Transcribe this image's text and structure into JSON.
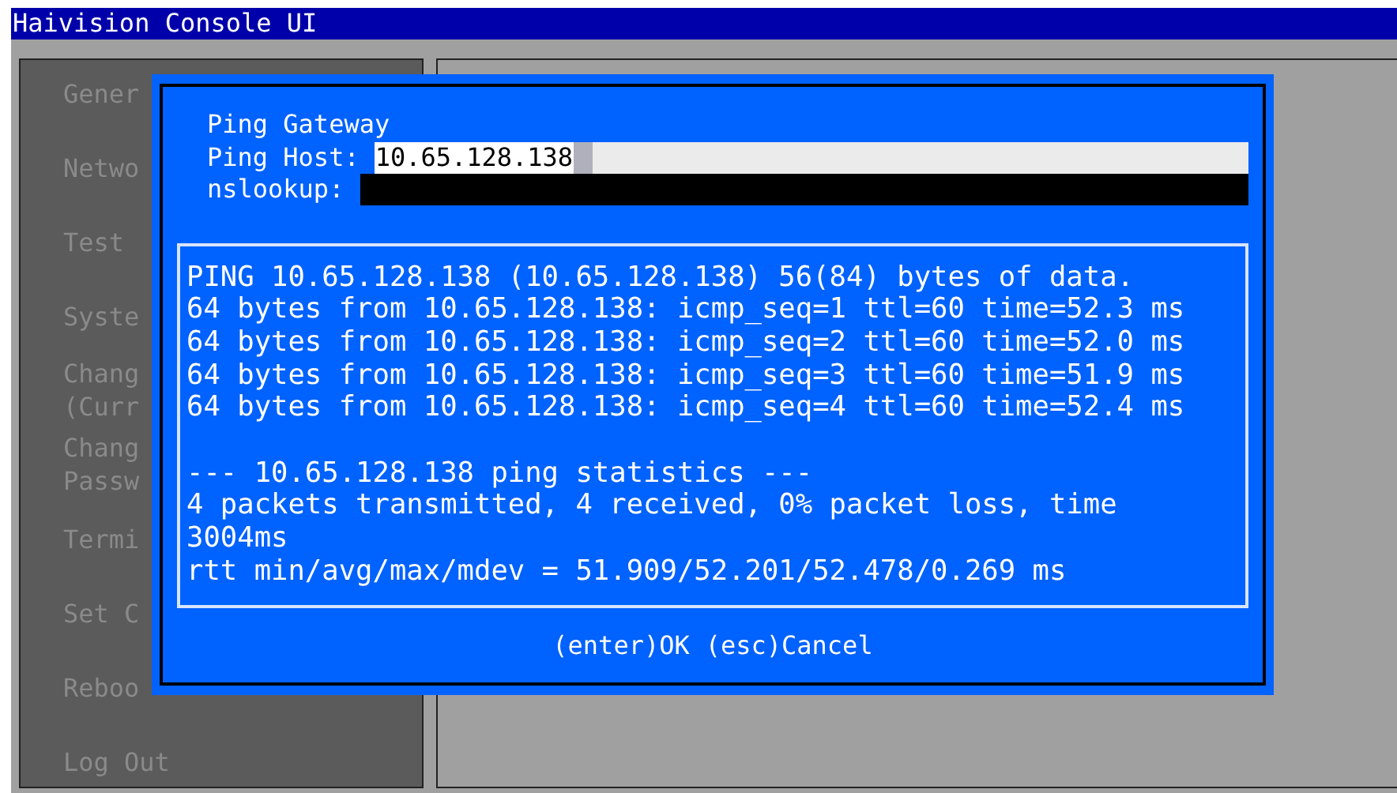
{
  "window": {
    "title": "Haivision Console UI"
  },
  "sidebar": {
    "items": [
      {
        "lines": [
          "Gener"
        ]
      },
      {
        "lines": [
          "Netwo"
        ]
      },
      {
        "lines": [
          "Test"
        ]
      },
      {
        "lines": [
          "Syste"
        ]
      },
      {
        "lines": [
          "Chang",
          "(Curr"
        ]
      },
      {
        "lines": [
          "Chang",
          "Passw"
        ]
      },
      {
        "lines": [
          "Termi"
        ]
      },
      {
        "lines": [
          "Set C"
        ]
      },
      {
        "lines": [
          "Reboo"
        ]
      },
      {
        "lines": [
          "Log Out"
        ]
      }
    ]
  },
  "dialog": {
    "title": "Ping Gateway",
    "fields": [
      {
        "label": "Ping Host:",
        "value": "10.65.128.138",
        "focused": true
      },
      {
        "label": "nslookup:",
        "focused": false
      }
    ],
    "output": {
      "ping_lines": [
        "PING 10.65.128.138 (10.65.128.138) 56(84) bytes of data.",
        "64 bytes from 10.65.128.138: icmp_seq=1 ttl=60 time=52.3 ms",
        "64 bytes from 10.65.128.138: icmp_seq=2 ttl=60 time=52.0 ms",
        "64 bytes from 10.65.128.138: icmp_seq=3 ttl=60 time=51.9 ms",
        "64 bytes from 10.65.128.138: icmp_seq=4 ttl=60 time=52.4 ms"
      ],
      "statistics_lines": [
        "--- 10.65.128.138 ping statistics ---",
        "4 packets transmitted, 4 received, 0% packet loss, time 3004ms",
        "rtt min/avg/max/mdev = 51.909/52.201/52.478/0.269 ms"
      ]
    },
    "buttons": [
      "(enter)OK",
      "(esc)Cancel"
    ]
  }
}
